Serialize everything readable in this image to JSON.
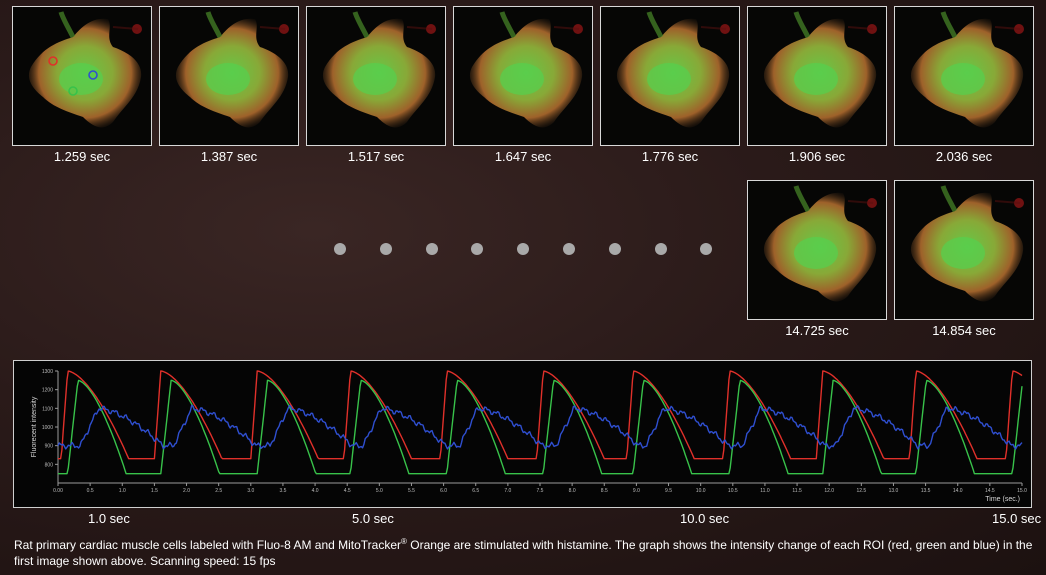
{
  "frames_top": [
    {
      "time": "1.259 sec",
      "rois": true
    },
    {
      "time": "1.387 sec"
    },
    {
      "time": "1.517 sec"
    },
    {
      "time": "1.647 sec"
    },
    {
      "time": "1.776 sec"
    },
    {
      "time": "1.906 sec"
    },
    {
      "time": "2.036 sec"
    }
  ],
  "frames_bottom": [
    {
      "time": "14.725 sec"
    },
    {
      "time": "14.854 sec"
    }
  ],
  "ellipsis_dots": 9,
  "colors": {
    "roi_red": "#e0302a",
    "roi_green": "#38c24a",
    "roi_blue": "#2f4fd0",
    "background": "#2a1a19",
    "dots": "#a9a9a9"
  },
  "chart_data": {
    "type": "line",
    "ylabel": "Fluorecent intensity",
    "xlabel": "Time (sec.)",
    "xlim": [
      0,
      15
    ],
    "ylim": [
      700,
      1300
    ],
    "x_ticks": [
      "0.00",
      "0.5",
      "1.0",
      "1.5",
      "2.0",
      "2.5",
      "3.0",
      "3.5",
      "4.0",
      "4.5",
      "5.0",
      "5.5",
      "6.0",
      "6.5",
      "7.0",
      "7.5",
      "8.0",
      "8.5",
      "9.0",
      "9.5",
      "10.0",
      "10.5",
      "11.0",
      "11.5",
      "12.0",
      "12.5",
      "13.0",
      "13.5",
      "14.0",
      "14.5",
      "15.0"
    ],
    "y_ticks": [
      "800",
      "900",
      "1000",
      "1100",
      "1200",
      "1300"
    ],
    "beat_times": [
      0.05,
      1.5,
      3.0,
      4.45,
      5.95,
      7.45,
      8.85,
      10.35,
      11.8,
      13.25,
      14.75
    ],
    "series": [
      {
        "name": "red",
        "peak": 1300,
        "trough": 830
      },
      {
        "name": "green",
        "peak": 1250,
        "trough": 750
      },
      {
        "name": "blue",
        "peak": 1100,
        "trough": 900
      }
    ]
  },
  "big_ticks": [
    "1.0 sec",
    "5.0 sec",
    "10.0 sec",
    "15.0 sec"
  ],
  "caption": {
    "part1": "Rat primary cardiac muscle cells labeled with Fluo-8 AM and MitoTracker",
    "reg": "®",
    "part2": " Orange are stimulated with histamine. The graph shows the intensity change of each ROI (red, green and blue) in the first image shown above. Scanning speed: 15 fps"
  }
}
